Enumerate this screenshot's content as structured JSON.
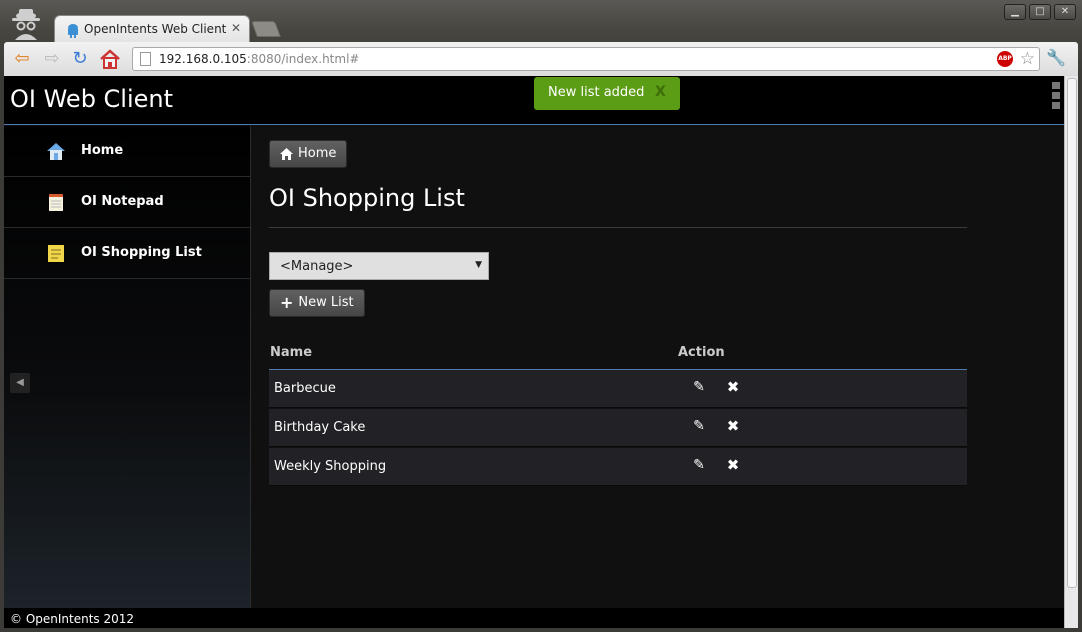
{
  "browser": {
    "tab_title": "OpenIntents Web Client",
    "tab_close": "✕",
    "url_host": "192.168.0.105",
    "url_rest": ":8080/index.html#",
    "abp_label": "ABP"
  },
  "header": {
    "brand": "OI Web Client",
    "toast_message": "New list added",
    "toast_close": "X"
  },
  "sidebar": {
    "items": [
      {
        "label": "Home",
        "icon": "home-icon"
      },
      {
        "label": "OI Notepad",
        "icon": "notepad-icon"
      },
      {
        "label": "OI Shopping List",
        "icon": "shopping-list-icon"
      }
    ]
  },
  "main": {
    "breadcrumb": "Home",
    "title": "OI Shopping List",
    "select_value": "<Manage>",
    "new_list_label": "New List",
    "table": {
      "headers": [
        "Name",
        "Action"
      ],
      "rows": [
        {
          "name": "Barbecue"
        },
        {
          "name": "Birthday Cake"
        },
        {
          "name": "Weekly Shopping"
        }
      ]
    }
  },
  "footer": {
    "text": "© OpenIntents 2012"
  },
  "colors": {
    "toast_bg": "#5c9d16",
    "accent_line": "#4f7bb0",
    "row_bg": "#212126"
  }
}
